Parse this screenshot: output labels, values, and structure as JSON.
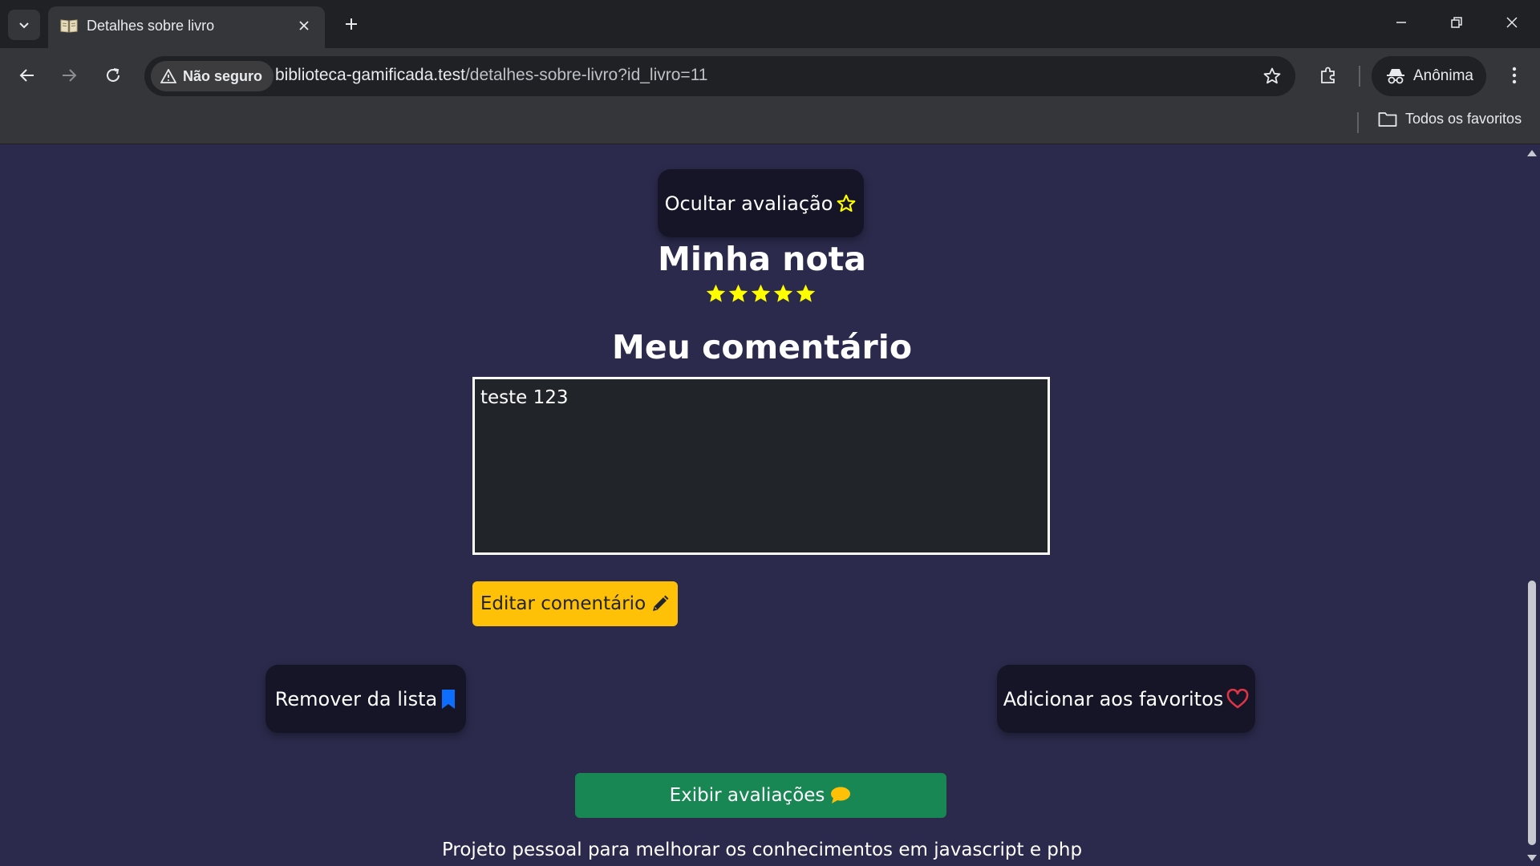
{
  "browser": {
    "tab_title": "Detalhes sobre livro",
    "security_label": "Não seguro",
    "url_host": "biblioteca-gamificada.test",
    "url_path": "/detalhes-sobre-livro?id_livro=11",
    "profile_label": "Anônima",
    "bookmarks_all": "Todos os favoritos"
  },
  "page": {
    "hide_rating_label": "Ocultar avaliação",
    "my_rating_title": "Minha nota",
    "rating_value": 5,
    "rating_max": 5,
    "my_comment_title": "Meu comentário",
    "comment_text": "teste 123",
    "edit_comment_label": "Editar comentário",
    "remove_list_label": "Remover da lista",
    "add_favorites_label": "Adicionar aos favoritos",
    "show_reviews_label": "Exibir avaliações",
    "footer_text": "Projeto pessoal para melhorar os conhecimentos em javascript e php"
  },
  "icons": {
    "tab_favicon": "book-icon",
    "hide_rating": "star-outline-icon",
    "rating_star": "star-filled-icon",
    "edit": "pencil-icon",
    "remove_list": "bookmark-icon",
    "favorites": "heart-outline-icon",
    "reviews": "chat-bubble-icon"
  },
  "colors": {
    "page_bg": "#2b2a4c",
    "dark_button_bg": "#161528",
    "star_yellow": "#ffff00",
    "edit_button_bg": "#ffc107",
    "reviews_button_bg": "#198754",
    "bookmark_blue": "#0d6efd",
    "heart_red": "#dc3545"
  }
}
